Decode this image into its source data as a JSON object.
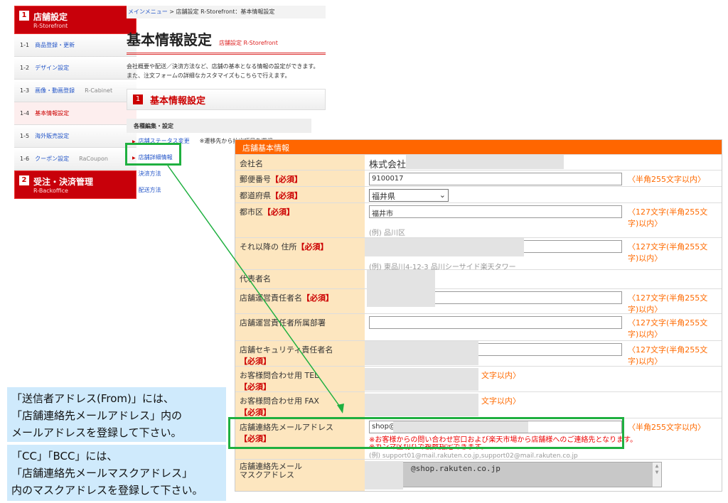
{
  "sidebar": {
    "sec1": {
      "num": "1",
      "title": "店舗設定",
      "sub": "R-Storefront"
    },
    "items": [
      {
        "num": "1-1",
        "label": "商品登録・更新",
        "sub": ""
      },
      {
        "num": "1-2",
        "label": "デザイン設定",
        "sub": ""
      },
      {
        "num": "1-3",
        "label": "画像・動画登録",
        "sub": "R-Cabinet"
      },
      {
        "num": "1-4",
        "label": "基本情報設定",
        "sub": ""
      },
      {
        "num": "1-5",
        "label": "海外販売設定",
        "sub": ""
      },
      {
        "num": "1-6",
        "label": "クーポン設定",
        "sub": "RaCoupon"
      }
    ],
    "sec2": {
      "num": "2",
      "title": "受注・決済管理",
      "sub": "R-Backoffice"
    }
  },
  "main": {
    "breadcrumb_link": "メインメニュー",
    "breadcrumb_rest": " > 店舗設定  R-Storefront：基本情報設定",
    "title": "基本情報設定",
    "title_sub": "店舗設定 R-Storefront",
    "desc1": "会社概要や配送／決済方法など、店舗の基本となる情報の設定ができます。",
    "desc2": "また、注文フォームの詳細なカスタマイズもこちらで行えます。",
    "section_num": "1",
    "section_title": "基本情報設定",
    "sub_header": "各種編集・設定",
    "links": [
      "店舗ステータス変更",
      "店舗詳細情報",
      "決済方法",
      "配送方法"
    ],
    "note": "※遷移先から抽出項目を選択"
  },
  "form": {
    "header": "店舗基本情報",
    "req": "【必須】",
    "company_label": "会社名",
    "company_value": "株式会社",
    "zip_label": "郵便番号",
    "zip_value": "9100017",
    "hint255": "〈半角255文字以内〉",
    "pref_label": "都道府県",
    "pref_value": "福井県",
    "city_label": "都市区",
    "city_value": "福井市",
    "hint127": "〈127文字(半角255文字)以内〉",
    "city_example": "(例) 品川区",
    "addr_label": "それ以降の 住所",
    "addr_example": "(例) 東品川4-12-3 品川シーサイド楽天タワー",
    "rep_label": "代表者名",
    "mgr_label": "店舗運営責任者名",
    "dept_label": "店舗運営責任者所属部署",
    "sec_label": "店舗セキュリティ責任者名",
    "tel_label": "お客様問合わせ用 TEL",
    "tel_hint": "文字以内〉",
    "fax_label": "お客様問合わせ用 FAX",
    "email_label": "店舗連絡先メールアドレス",
    "email_value": "shop@",
    "email_warn1": "※お客様からの問い合わせ窓口および楽天市場から店舗様へのご連絡先となります。",
    "email_warn2": "※カンマ区切りで複数指定できます。",
    "email_example": "(例) support01@mail.rakuten.co.jp,support02@mail.rakuten.co.jp",
    "mask_label1": "店舗連絡先メール",
    "mask_label2": "マスクアドレス",
    "mask_value": "@shop.rakuten.co.jp"
  },
  "callouts": {
    "c1": [
      "「送信者アドレス(From)」には、",
      "「店舗連絡先メールアドレス」内の",
      "メールアドレスを登録して下さい。"
    ],
    "c2": [
      "「CC」「BCC」には、",
      "「店舗連絡先メールマスクアドレス」",
      "内のマスクアドレスを登録して下さい。"
    ]
  }
}
